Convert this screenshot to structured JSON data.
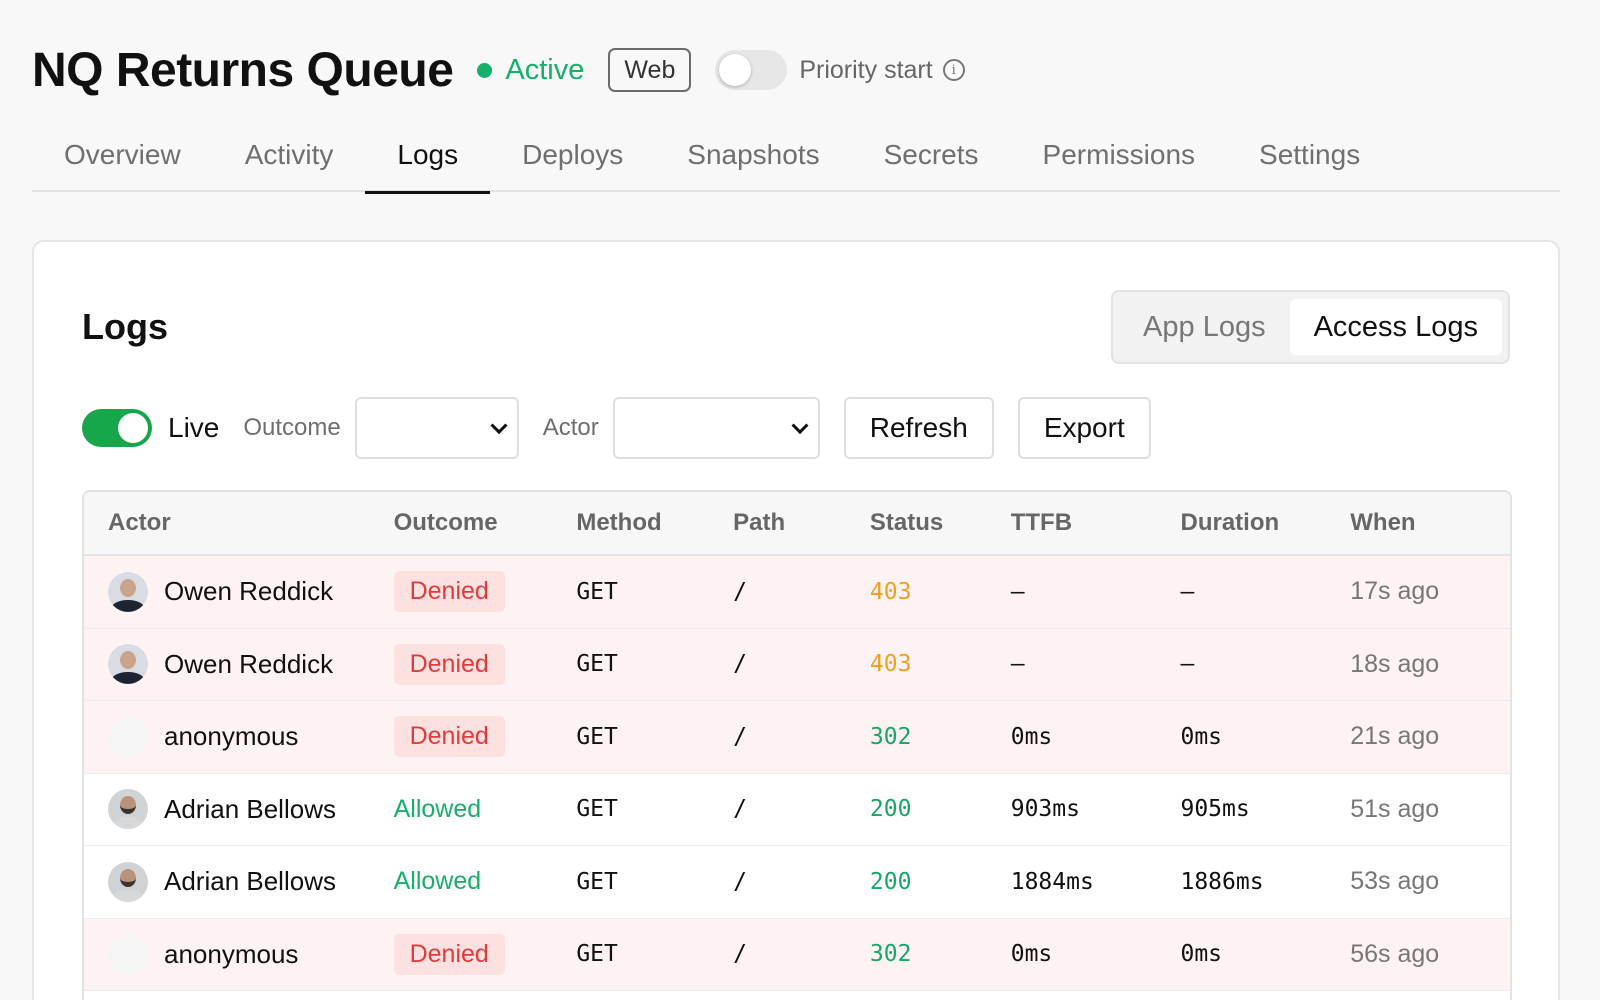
{
  "header": {
    "title": "NQ Returns Queue",
    "status": "Active",
    "badge": "Web",
    "priority_label": "Priority start",
    "priority_enabled": false
  },
  "tabs": [
    {
      "label": "Overview",
      "active": false
    },
    {
      "label": "Activity",
      "active": false
    },
    {
      "label": "Logs",
      "active": true
    },
    {
      "label": "Deploys",
      "active": false
    },
    {
      "label": "Snapshots",
      "active": false
    },
    {
      "label": "Secrets",
      "active": false
    },
    {
      "label": "Permissions",
      "active": false
    },
    {
      "label": "Settings",
      "active": false
    }
  ],
  "logs": {
    "title": "Logs",
    "segments": [
      {
        "label": "App Logs",
        "active": false
      },
      {
        "label": "Access Logs",
        "active": true
      }
    ],
    "live_label": "Live",
    "live_enabled": true,
    "outcome_label": "Outcome",
    "outcome_value": "",
    "actor_label": "Actor",
    "actor_value": "",
    "refresh_label": "Refresh",
    "export_label": "Export"
  },
  "table": {
    "columns": [
      "Actor",
      "Outcome",
      "Method",
      "Path",
      "Status",
      "TTFB",
      "Duration",
      "When"
    ],
    "rows": [
      {
        "actor": "Owen Reddick",
        "avatar": "a1",
        "outcome": "Denied",
        "method": "GET",
        "path": "/",
        "status": "403",
        "ttfb": "–",
        "duration": "–",
        "when": "17s ago"
      },
      {
        "actor": "Owen Reddick",
        "avatar": "a1",
        "outcome": "Denied",
        "method": "GET",
        "path": "/",
        "status": "403",
        "ttfb": "–",
        "duration": "–",
        "when": "18s ago"
      },
      {
        "actor": "anonymous",
        "avatar": "anon",
        "outcome": "Denied",
        "method": "GET",
        "path": "/",
        "status": "302",
        "ttfb": "0ms",
        "duration": "0ms",
        "when": "21s ago"
      },
      {
        "actor": "Adrian Bellows",
        "avatar": "a2",
        "outcome": "Allowed",
        "method": "GET",
        "path": "/",
        "status": "200",
        "ttfb": "903ms",
        "duration": "905ms",
        "when": "51s ago"
      },
      {
        "actor": "Adrian Bellows",
        "avatar": "a2",
        "outcome": "Allowed",
        "method": "GET",
        "path": "/",
        "status": "200",
        "ttfb": "1884ms",
        "duration": "1886ms",
        "when": "53s ago"
      },
      {
        "actor": "anonymous",
        "avatar": "anon",
        "outcome": "Denied",
        "method": "GET",
        "path": "/",
        "status": "302",
        "ttfb": "0ms",
        "duration": "0ms",
        "when": "56s ago"
      }
    ]
  },
  "colors": {
    "active_green": "#16b06b",
    "denied_red": "#e23b3b",
    "denied_row_bg": "#fff2f2",
    "status_403": "#f0a020",
    "status_ok": "#16a868",
    "toggle_on": "#17a64a"
  }
}
